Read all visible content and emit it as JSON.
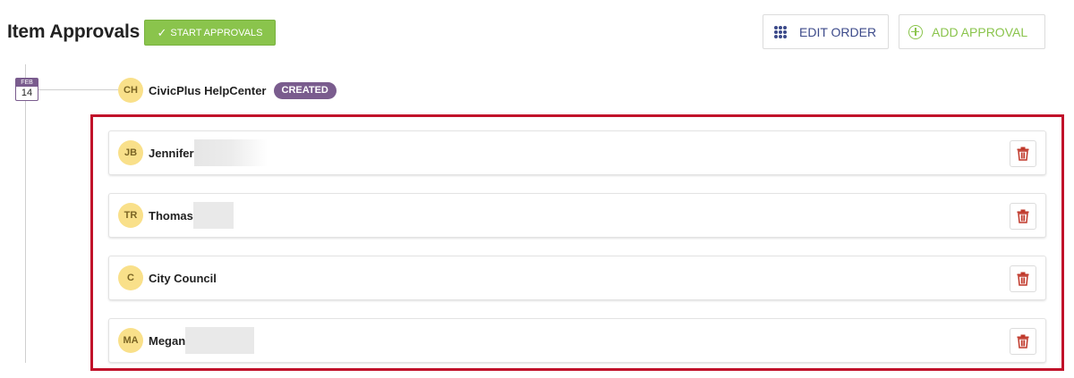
{
  "header": {
    "title": "Item Approvals",
    "start_approvals_label": "START APPROVALS",
    "edit_order_label": "EDIT ORDER",
    "add_approval_label": "ADD APPROVAL"
  },
  "timeline": {
    "date_month": "FEB",
    "date_day": "14",
    "creator": {
      "initials": "CH",
      "name": "CivicPlus HelpCenter",
      "status": "CREATED"
    }
  },
  "approvers": [
    {
      "initials": "JB",
      "name": "Jennifer"
    },
    {
      "initials": "TR",
      "name": "Thomas"
    },
    {
      "initials": "C",
      "name": "City Council"
    },
    {
      "initials": "MA",
      "name": "Megan"
    }
  ],
  "colors": {
    "accent_green": "#8ac44c",
    "accent_purple": "#7a5c8e",
    "highlight_red": "#c1112a",
    "avatar_yellow": "#f9e08a",
    "trash_red": "#c0392b",
    "edit_blue": "#3c4a8a"
  },
  "icons": {
    "start_button": "check-icon",
    "edit_order": "grid-dots-icon",
    "add_approval": "plus-circle-icon",
    "delete": "trash-icon"
  }
}
